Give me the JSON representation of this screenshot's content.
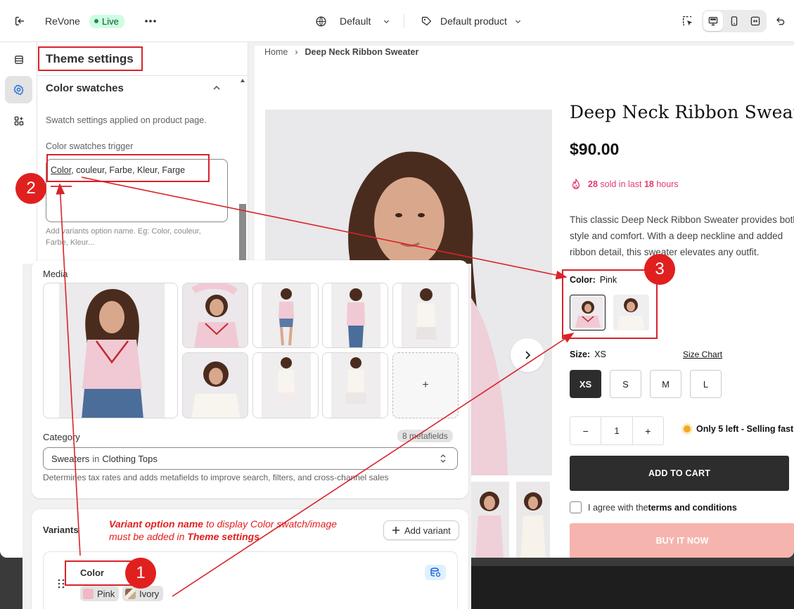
{
  "topbar": {
    "store_name": "ReVone",
    "live_label": "Live",
    "theme_select": "Default",
    "template_select": "Default product"
  },
  "settings": {
    "panel_title": "Theme settings",
    "section_title": "Color swatches",
    "section_help": "Swatch settings applied on product page.",
    "trigger_label": "Color swatches trigger",
    "trigger_value_first": "Color",
    "trigger_value_rest": ", couleur, Farbe, Kleur, Farge",
    "trigger_help": "Add variants option name. Eg: Color, couleur, Farbe, Kleur..."
  },
  "preview": {
    "breadcrumb_home": "Home",
    "breadcrumb_current": "Deep Neck Ribbon Sweater",
    "product_title": "Deep Neck Ribbon Sweater",
    "price": "$90.00",
    "sold_count": "28",
    "sold_mid": "sold in last",
    "sold_hours": "18",
    "sold_unit": "hours",
    "description": "This classic Deep Neck Ribbon Sweater provides both style and comfort. With a deep neckline and added ribbon detail, this sweater elevates any outfit.",
    "color_label": "Color:",
    "color_value": "Pink",
    "size_label": "Size:",
    "size_value": "XS",
    "size_chart": "Size Chart",
    "sizes": [
      "XS",
      "S",
      "M",
      "L"
    ],
    "quantity": "1",
    "stock_text": "Only 5 left - Selling fast",
    "add_to_cart": "ADD TO CART",
    "agree_prefix": "I agree with the",
    "agree_link": "terms and conditions",
    "buy_now": "BUY IT NOW"
  },
  "admin": {
    "media_label": "Media",
    "category_label": "Category",
    "metafields_badge": "8 metafields",
    "category_value_a": "Sweaters",
    "category_in": "in",
    "category_value_b": "Clothing Tops",
    "category_help": "Determines tax rates and adds metafields to improve search, filters, and cross-channel sales",
    "variants_label": "Variants",
    "add_variant": "Add variant",
    "option_name": "Color",
    "option_values": [
      "Pink",
      "Ivory"
    ]
  },
  "annotation": {
    "note_bold1": "Variant option name",
    "note_mid": " to display  Color swatch/image",
    "note_line2": " must be added in ",
    "note_bold2": "Theme settings",
    "markers": [
      "1",
      "2",
      "3"
    ]
  },
  "colors": {
    "annotation_red": "#d8232a",
    "live_green": "#cdfee1",
    "sold_pink": "#e33b6b",
    "buy_now_bg": "#f6b4ae",
    "dark_button": "#2d2d2d",
    "pink_swatch": "#f3b6c6",
    "ivory_swatch": "#c8ad8c"
  }
}
